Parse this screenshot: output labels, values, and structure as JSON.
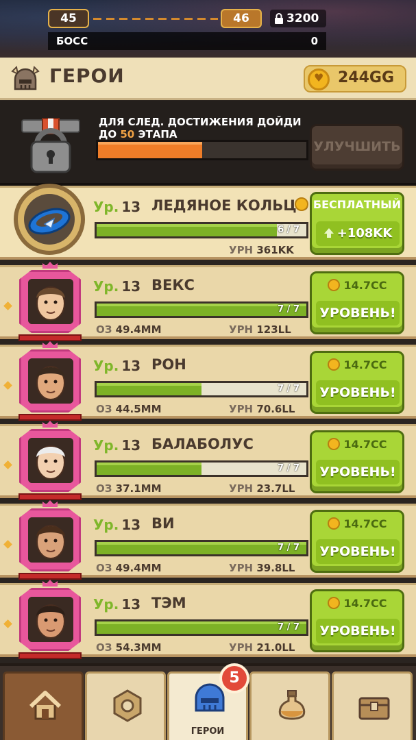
{
  "top": {
    "stage_current": "45",
    "stage_next": "46",
    "locked_value": "3200",
    "boss_label": "БОСС",
    "boss_value": "0"
  },
  "header": {
    "title": "ГЕРОИ",
    "currency": "244GG"
  },
  "achievement": {
    "text_line1": "ДЛЯ СЛЕД. ДОСТИЖЕНИЯ ДОЙДИ",
    "text_line2_prefix": "ДО",
    "stage_target": "50",
    "text_line2_suffix": "ЭТАПА",
    "progress": 0.5,
    "button_label": "УЛУЧШИТЬ"
  },
  "ring": {
    "level_prefix": "Ур.",
    "level": "13",
    "name": "ЛЕДЯНОЕ КОЛЬЦО",
    "progress_text": "6 / 7",
    "progress": 0.86,
    "stat_label": "УРН",
    "stat_value": "361KK",
    "button_top": "БЕСПЛАТНЫЙ",
    "button_main": "+108KK"
  },
  "heroes": [
    {
      "level_prefix": "Ур.",
      "level": "13",
      "name": "ВЕКС",
      "progress_text": "7 / 7",
      "progress": 1.0,
      "hp_label": "ОЗ",
      "hp": "49.4MM",
      "dmg_label": "УРН",
      "dmg": "123LL",
      "cost": "14.7CC",
      "button": "УРОВЕНЬ!"
    },
    {
      "level_prefix": "Ур.",
      "level": "13",
      "name": "РОН",
      "progress_text": "7 / 7",
      "progress": 0.5,
      "hp_label": "ОЗ",
      "hp": "44.5MM",
      "dmg_label": "УРН",
      "dmg": "70.6LL",
      "cost": "14.7CC",
      "button": "УРОВЕНЬ!"
    },
    {
      "level_prefix": "Ур.",
      "level": "13",
      "name": "БАЛАБОЛУС",
      "progress_text": "7 / 7",
      "progress": 0.5,
      "hp_label": "ОЗ",
      "hp": "37.1MM",
      "dmg_label": "УРН",
      "dmg": "23.7LL",
      "cost": "14.7CC",
      "button": "УРОВЕНЬ!"
    },
    {
      "level_prefix": "Ур.",
      "level": "13",
      "name": "ВИ",
      "progress_text": "7 / 7",
      "progress": 1.0,
      "hp_label": "ОЗ",
      "hp": "49.4MM",
      "dmg_label": "УРН",
      "dmg": "39.8LL",
      "cost": "14.7CC",
      "button": "УРОВЕНЬ!"
    },
    {
      "level_prefix": "Ур.",
      "level": "13",
      "name": "ТЭМ",
      "progress_text": "7 / 7",
      "progress": 1.0,
      "hp_label": "ОЗ",
      "hp": "54.3MM",
      "dmg_label": "УРН",
      "dmg": "21.0LL",
      "cost": "14.7CC",
      "button": "УРОВЕНЬ!"
    }
  ],
  "nav": {
    "active_label": "ГЕРОИ",
    "badge": "5"
  }
}
